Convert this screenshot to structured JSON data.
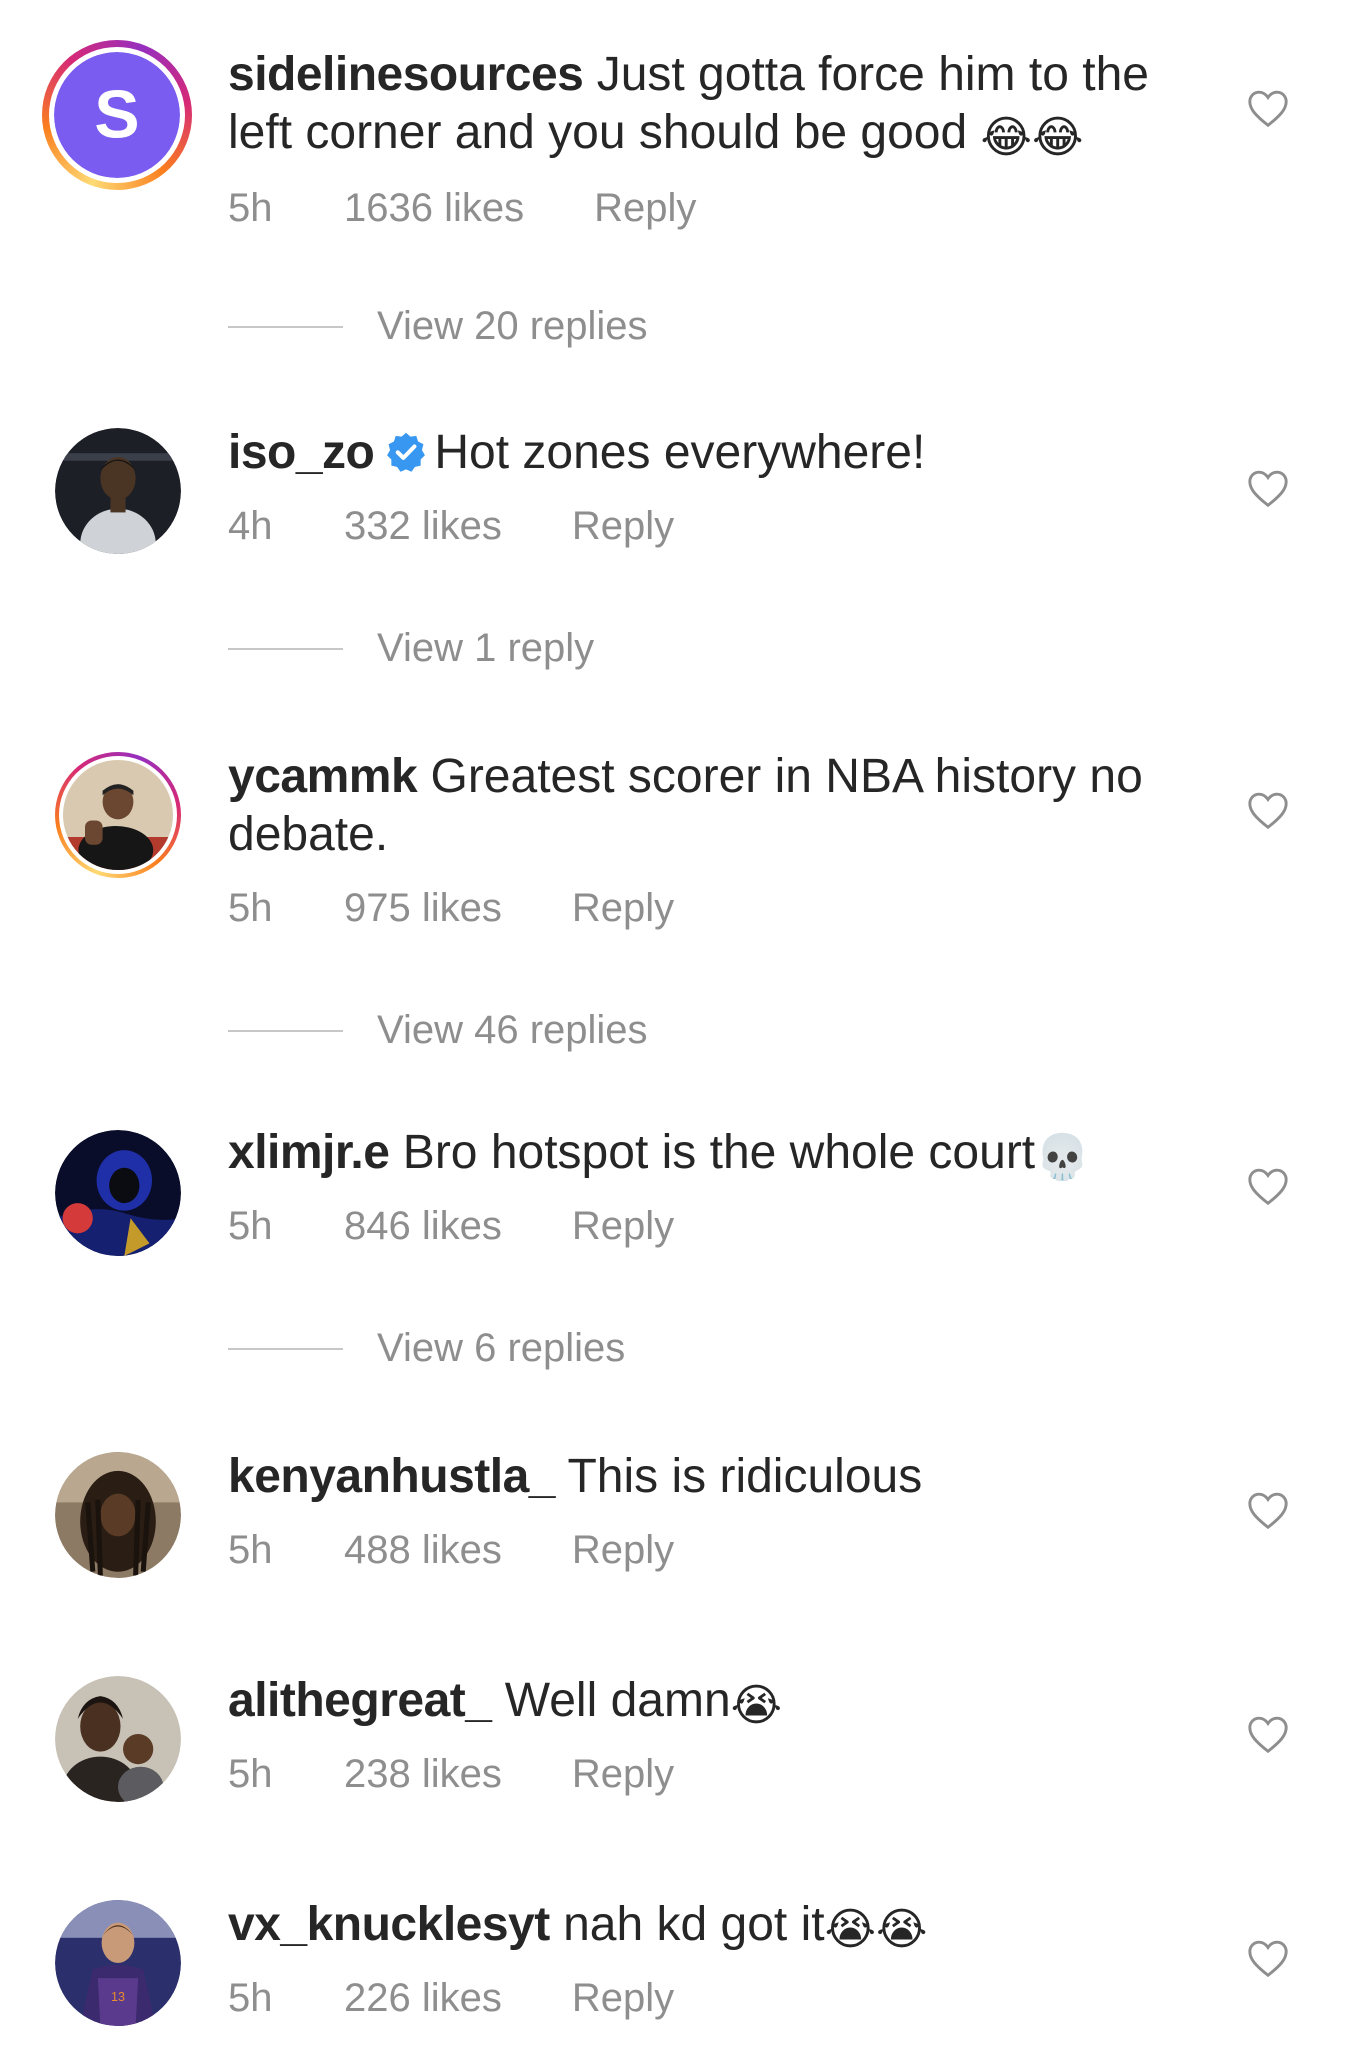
{
  "comments": [
    {
      "username": "sidelinesources",
      "text": "Just gotta force him to the left corner and you should be good",
      "emoji": "😂😂",
      "time": "5h",
      "likes": "1636 likes",
      "reply": "Reply",
      "view_replies": "View 20 replies"
    },
    {
      "username": "iso_zo",
      "text": "Hot zones everywhere!",
      "emoji": "",
      "time": "4h",
      "likes": "332 likes",
      "reply": "Reply",
      "view_replies": "View 1 reply"
    },
    {
      "username": "ycammk",
      "text": "Greatest scorer in NBA history no debate.",
      "emoji": "",
      "time": "5h",
      "likes": "975 likes",
      "reply": "Reply",
      "view_replies": "View 46 replies"
    },
    {
      "username": "xlimjr.e",
      "text": "Bro hotspot is the whole court",
      "emoji": "💀",
      "time": "5h",
      "likes": "846 likes",
      "reply": "Reply",
      "view_replies": "View 6 replies"
    },
    {
      "username": "kenyanhustla_",
      "text": "This is ridiculous",
      "emoji": "",
      "time": "5h",
      "likes": "488 likes",
      "reply": "Reply"
    },
    {
      "username": "alithegreat_",
      "text": "Well damn",
      "emoji": "😭",
      "time": "5h",
      "likes": "238 likes",
      "reply": "Reply"
    },
    {
      "username": "vx_knucklesyt",
      "text": "nah kd got it",
      "emoji": "😭😭",
      "time": "5h",
      "likes": "226 likes",
      "reply": "Reply"
    }
  ],
  "avatar_letter": "S",
  "colors": {
    "text": "#262626",
    "secondary": "#8e8e8e",
    "verified": "#3897f0",
    "story_ring_start": "#feda75",
    "story_ring_end": "#962fbf",
    "avatar_purple": "#6c5ce7"
  },
  "icons": [
    "verified-badge-icon",
    "heart-icon"
  ]
}
